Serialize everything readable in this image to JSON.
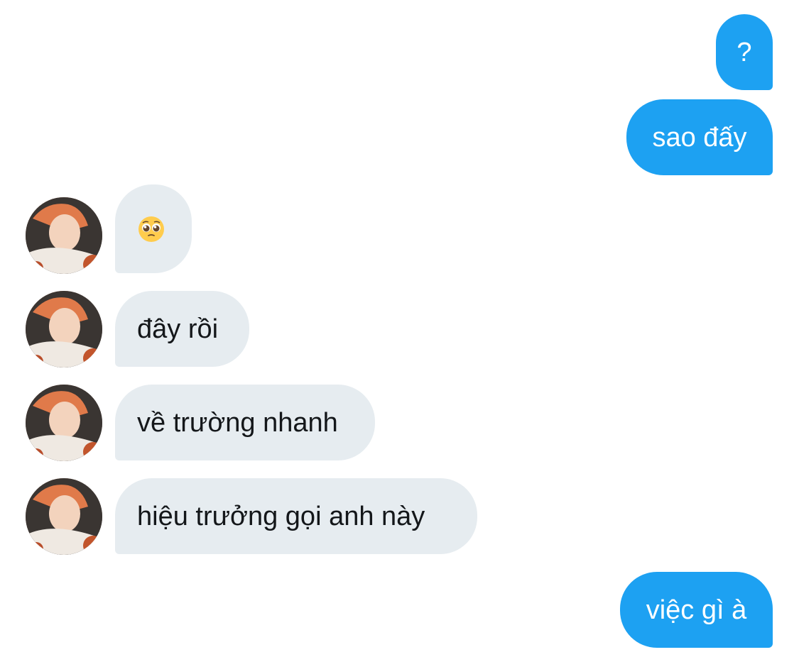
{
  "conversation": {
    "messages": [
      {
        "sender": "me",
        "text": "?"
      },
      {
        "sender": "me",
        "text": "sao đấy"
      },
      {
        "sender": "them",
        "emoji": "pleading-face",
        "text": ""
      },
      {
        "sender": "them",
        "text": "đây rồi"
      },
      {
        "sender": "them",
        "text": "về trường nhanh"
      },
      {
        "sender": "them",
        "text": "hiệu trưởng gọi anh này"
      },
      {
        "sender": "me",
        "text": "việc gì à"
      }
    ]
  },
  "colors": {
    "sent_bubble": "#1da1f2",
    "received_bubble": "#e6ecf0",
    "sent_text": "#ffffff",
    "received_text": "#14171a"
  },
  "icons": {
    "avatar": "contact-avatar-photo",
    "emoji": "pleading-face-emoji"
  }
}
